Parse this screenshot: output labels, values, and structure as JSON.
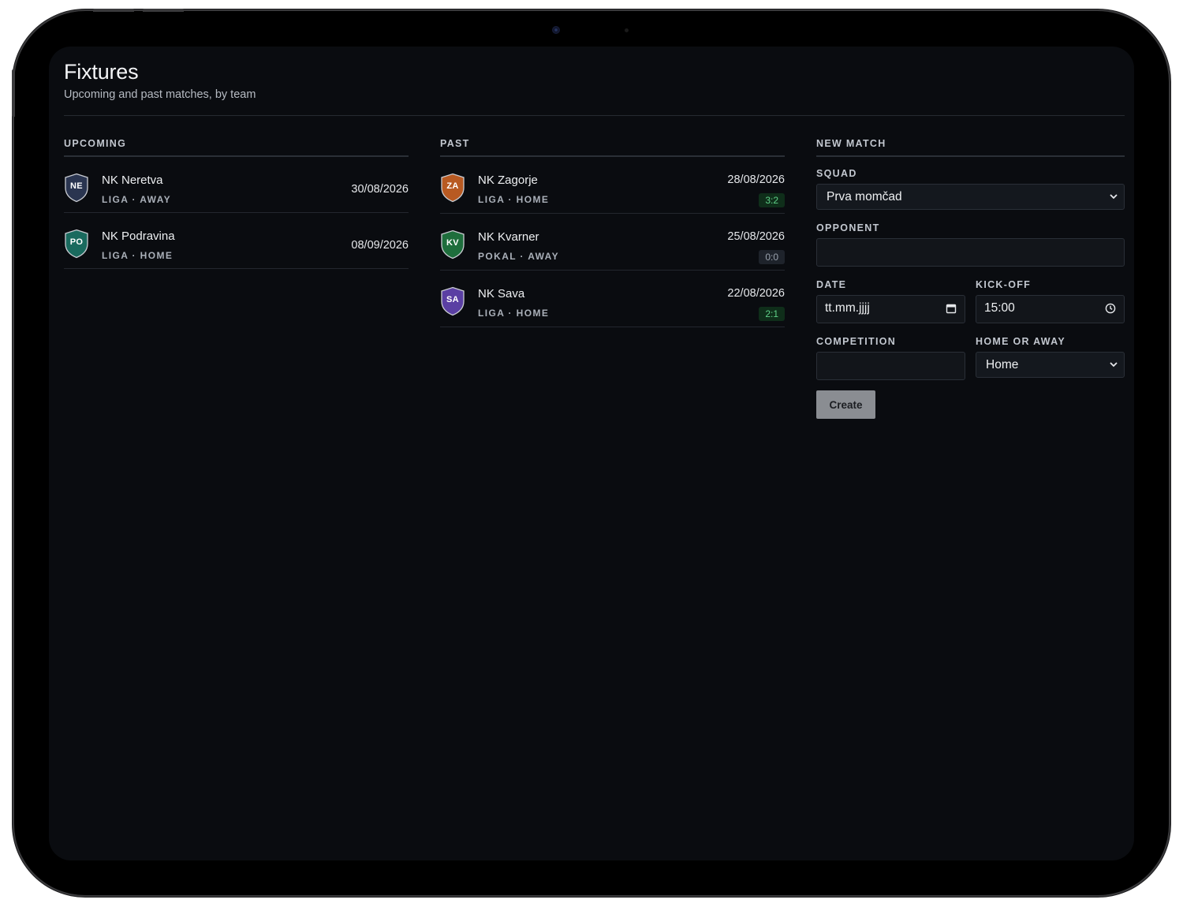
{
  "header": {
    "title": "Fixtures",
    "subtitle": "Upcoming and past matches, by team"
  },
  "upcoming": {
    "heading": "UPCOMING",
    "matches": [
      {
        "abbr": "NE",
        "opponent": "NK Neretva",
        "meta": "LIGA · AWAY",
        "date": "30/08/2026",
        "crest_color": "#2a3550"
      },
      {
        "abbr": "PO",
        "opponent": "NK Podravina",
        "meta": "LIGA · HOME",
        "date": "08/09/2026",
        "crest_color": "#1a6a5e"
      }
    ]
  },
  "past": {
    "heading": "PAST",
    "matches": [
      {
        "abbr": "ZA",
        "opponent": "NK Zagorje",
        "meta": "LIGA · HOME",
        "date": "28/08/2026",
        "score": "3:2",
        "result": "win",
        "crest_color": "#b85a22"
      },
      {
        "abbr": "KV",
        "opponent": "NK Kvarner",
        "meta": "POKAL · AWAY",
        "date": "25/08/2026",
        "score": "0:0",
        "result": "draw",
        "crest_color": "#1e6e3c"
      },
      {
        "abbr": "SA",
        "opponent": "NK Sava",
        "meta": "LIGA · HOME",
        "date": "22/08/2026",
        "score": "2:1",
        "result": "win",
        "crest_color": "#5a3fa3"
      }
    ]
  },
  "new_match": {
    "heading": "NEW MATCH",
    "squad_label": "SQUAD",
    "squad_value": "Prva momčad",
    "opponent_label": "OPPONENT",
    "opponent_value": "",
    "date_label": "DATE",
    "date_value": "tt.mm.jjjj",
    "kickoff_label": "KICK-OFF",
    "kickoff_value": "15:00",
    "competition_label": "COMPETITION",
    "competition_value": "",
    "home_away_label": "HOME OR AWAY",
    "home_away_value": "Home",
    "create_label": "Create"
  },
  "icons": {
    "select": "chevron-down-icon",
    "date": "calendar-icon",
    "time": "clock-icon",
    "crest": "shield-icon"
  },
  "colors": {
    "background": "#0a0c10",
    "win_bg": "#0f2e1a",
    "win_text": "#5fd088",
    "draw_bg": "#1e232b",
    "draw_text": "#9aa3ae",
    "button": "#8a8d92"
  }
}
